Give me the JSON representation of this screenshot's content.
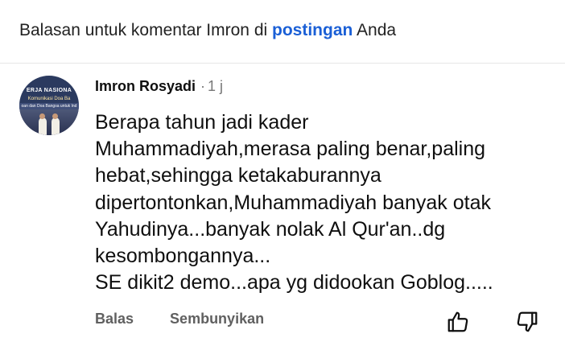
{
  "header": {
    "prefix": "Balasan untuk komentar Imron di ",
    "link": "postingan",
    "suffix": " Anda"
  },
  "comment": {
    "author": "Imron Rosyadi",
    "separator": "·",
    "time": "1 j",
    "avatar": {
      "line1": "ERJA NASIONA",
      "line2": "Komunikasi Doa Ba",
      "line3": "oan dan Doa Bangsa untuk Ind"
    },
    "lines": [
      "Berapa tahun jadi kader",
      "Muhammadiyah,merasa paling benar,paling",
      "hebat,sehingga ketakaburannya",
      "dipertontonkan,Muhammadiyah banyak otak",
      "Yahudinya...banyak nolak Al Qur'an..dg",
      "kesombongannya...",
      "SE dikit2 demo...apa yg didookan Goblog....."
    ]
  },
  "actions": {
    "reply": "Balas",
    "hide": "Sembunyikan",
    "like_icon": "thumbs-up-icon",
    "dislike_icon": "thumbs-down-icon"
  },
  "colors": {
    "link": "#1a5fd6",
    "action_text": "#606060",
    "meta_text": "#777777"
  }
}
